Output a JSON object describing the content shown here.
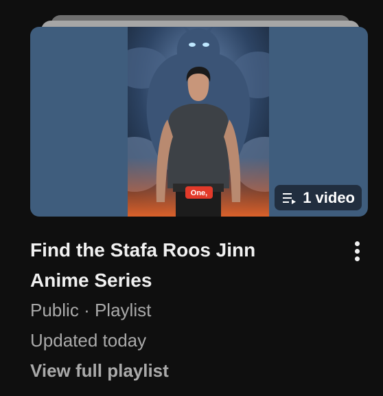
{
  "playlist": {
    "title": "Find the Stafa Roos Jinn Anime Series",
    "video_count": "1 video",
    "visibility": "Public",
    "separator": "·",
    "type": "Playlist",
    "updated": "Updated today",
    "view_link": "View full playlist",
    "thumbnail_caption": "One,"
  },
  "icons": {
    "badge": "playlist-icon",
    "menu": "more-vert-icon"
  },
  "colors": {
    "background": "#0f0f0f",
    "thumbnail_side": "#3f5d7d",
    "title": "#f1f1f1",
    "meta": "#aaaaaa",
    "caption_bg": "#e23a2a"
  }
}
